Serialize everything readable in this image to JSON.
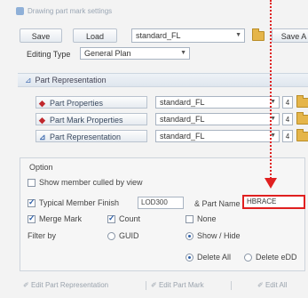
{
  "window": {
    "title": "Drawing part mark settings"
  },
  "toolbar": {
    "save_label": "Save",
    "load_label": "Load",
    "settings_value": "standard_FL",
    "save_as_label": "Save A"
  },
  "editing": {
    "label": "Editing Type",
    "value": "General Plan"
  },
  "part_representation": {
    "header": "Part Representation",
    "rows": [
      {
        "label": "Part Properties",
        "value": "standard_FL",
        "num": "4"
      },
      {
        "label": "Part Mark Properties",
        "value": "standard_FL",
        "num": "4"
      },
      {
        "label": "Part Representation",
        "value": "standard_FL",
        "num": "4"
      }
    ]
  },
  "option": {
    "title": "Option",
    "show_member_label": "Show member culled by view",
    "typical_member_label": "Typical Member Finish",
    "typical_member_value": "LOD300",
    "part_name_label": "& Part Name",
    "part_name_value": "HBRACE",
    "merge_mark_label": "Merge Mark",
    "count_label": "Count",
    "none_label": "None",
    "filter_label": "Filter by",
    "guid_label": "GUID",
    "show_hide_label": "Show / Hide",
    "delete_all_label": "Delete All",
    "delete_edit_label": "Delete eDD"
  },
  "bottom": {
    "edit_part_rep": "Edit Part Representation",
    "edit_part_mark": "Edit Part Mark",
    "edit_all": "Edit All"
  }
}
